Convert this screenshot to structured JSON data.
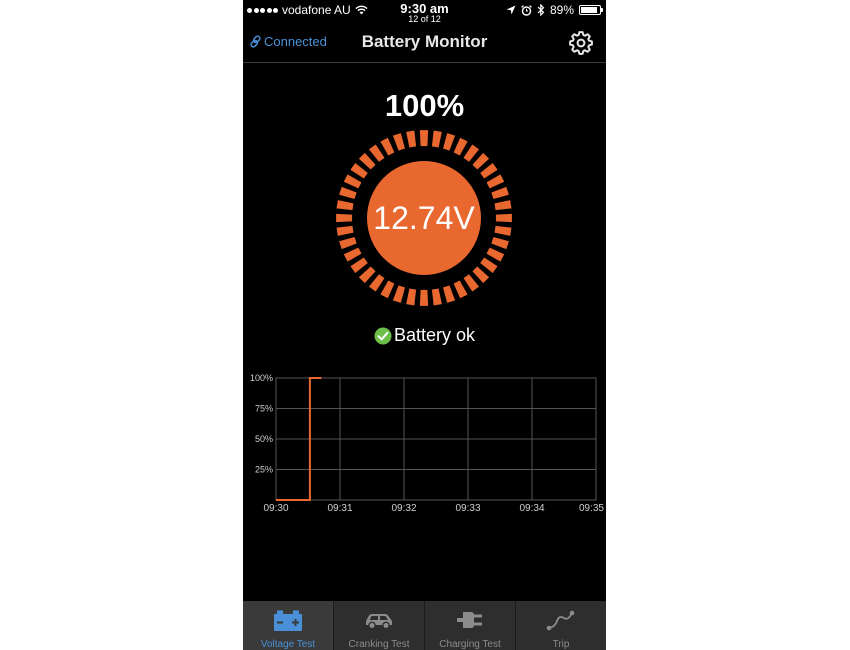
{
  "status_bar": {
    "carrier": "vodafone AU",
    "time": "9:30 am",
    "counter": "12 of 12",
    "battery_percent": "89%",
    "battery_level": 0.89
  },
  "nav": {
    "connected_label": "Connected",
    "title": "Battery Monitor"
  },
  "gauge": {
    "percent_label": "100%",
    "voltage_label": "12.74V",
    "level": 1.0,
    "segment_count": 40,
    "accent_color": "#e8682f"
  },
  "status": {
    "label": "Battery ok",
    "check_color": "#6cc04a"
  },
  "chart_data": {
    "type": "line",
    "x_ticks": [
      "09:30",
      "09:31",
      "09:32",
      "09:33",
      "09:34",
      "09:35"
    ],
    "y_ticks": [
      "25%",
      "50%",
      "75%",
      "100%"
    ],
    "xlim": [
      0,
      5
    ],
    "ylim": [
      0,
      100
    ],
    "grid": true,
    "series": [
      {
        "color": "#e8682f",
        "points": [
          [
            0,
            0
          ],
          [
            0.53,
            0
          ],
          [
            0.53,
            100
          ],
          [
            0.71,
            100
          ]
        ]
      }
    ]
  },
  "tabs": [
    {
      "label": "Voltage Test",
      "icon": "battery-icon",
      "active": true
    },
    {
      "label": "Cranking Test",
      "icon": "car-icon",
      "active": false
    },
    {
      "label": "Charging Test",
      "icon": "plug-icon",
      "active": false
    },
    {
      "label": "Trip",
      "icon": "route-icon",
      "active": false
    }
  ]
}
